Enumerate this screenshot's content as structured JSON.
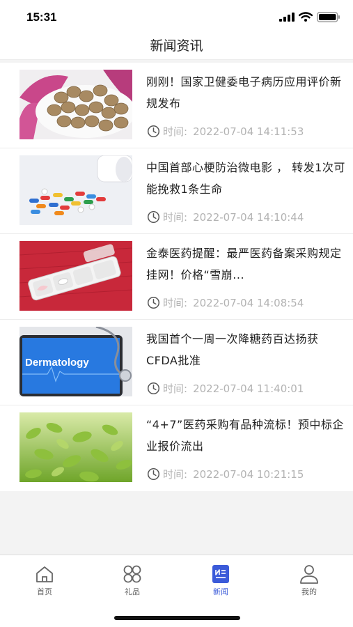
{
  "status_bar": {
    "time": "15:31"
  },
  "nav": {
    "title": "新闻资讯"
  },
  "news": [
    {
      "title": "刚刚！国家卫健委电子病历应用评价新规发布",
      "time_label": "时间:",
      "time": "2022-07-04 14:11:53",
      "thumb": "pills-on-plate"
    },
    {
      "title": "中国首部心梗防治微电影 ， 转发1次可能挽救1条生命",
      "time_label": "时间:",
      "time": "2022-07-04 14:10:44",
      "thumb": "capsules-and-bottle"
    },
    {
      "title": "金泰医药提醒：最严医药备案采购规定挂网！价格“雪崩...",
      "time_label": "时间:",
      "time": "2022-07-04 14:08:54",
      "thumb": "pill-organizer"
    },
    {
      "title": "我国首个一周一次降糖药百达扬获CFDA批准",
      "time_label": "时间:",
      "time": "2022-07-04 11:40:01",
      "thumb": "dermatology-tablet",
      "thumb_text": "Dermatology"
    },
    {
      "title": "“4+7”医药采购有品种流标！预中标企业报价流出",
      "time_label": "时间:",
      "time": "2022-07-04 10:21:15",
      "thumb": "green-leaves"
    }
  ],
  "tabs": [
    {
      "label": "首页",
      "icon": "home-icon",
      "active": false
    },
    {
      "label": "礼品",
      "icon": "gift-grid-icon",
      "active": false
    },
    {
      "label": "新闻",
      "icon": "news-icon",
      "active": true
    },
    {
      "label": "我的",
      "icon": "profile-icon",
      "active": false
    }
  ],
  "colors": {
    "accent": "#3b5bd9",
    "meta_text": "#b3b3b3"
  }
}
